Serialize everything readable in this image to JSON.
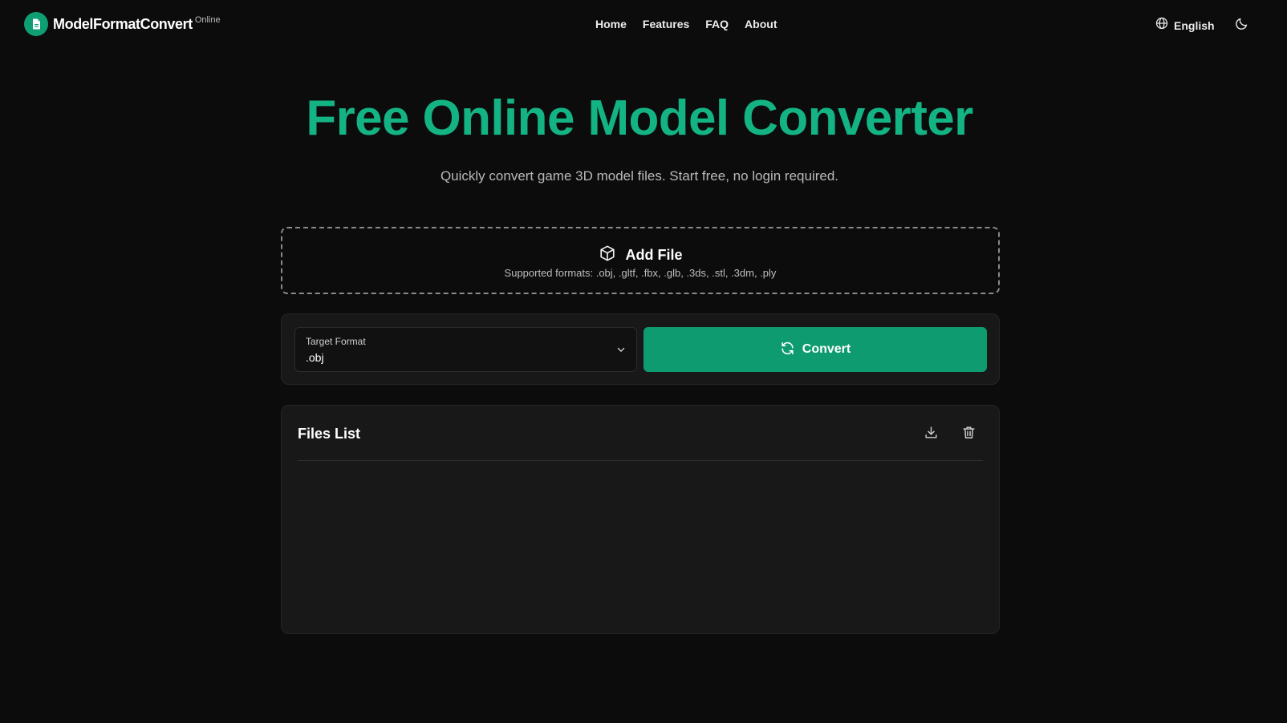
{
  "header": {
    "logo_name": "ModelFormatConvert",
    "logo_sup": "Online",
    "nav": [
      {
        "label": "Home"
      },
      {
        "label": "Features"
      },
      {
        "label": "FAQ"
      },
      {
        "label": "About"
      }
    ],
    "language": "English"
  },
  "hero": {
    "title": "Free Online Model Converter",
    "subtitle": "Quickly convert game 3D model files. Start free, no login required."
  },
  "dropzone": {
    "title": "Add File",
    "formats": "Supported formats: .obj, .gltf, .fbx, .glb, .3ds, .stl, .3dm, .ply"
  },
  "convert": {
    "target_label": "Target Format",
    "target_value": ".obj",
    "button_label": "Convert"
  },
  "files": {
    "title": "Files List"
  },
  "colors": {
    "accent": "#14b384",
    "button": "#0f9b70",
    "background": "#0c0c0c",
    "panel": "#181818"
  },
  "icons": [
    "file-icon",
    "globe-icon",
    "moon-icon",
    "cube-icon",
    "chevron-down-icon",
    "refresh-icon",
    "download-icon",
    "trash-icon"
  ]
}
